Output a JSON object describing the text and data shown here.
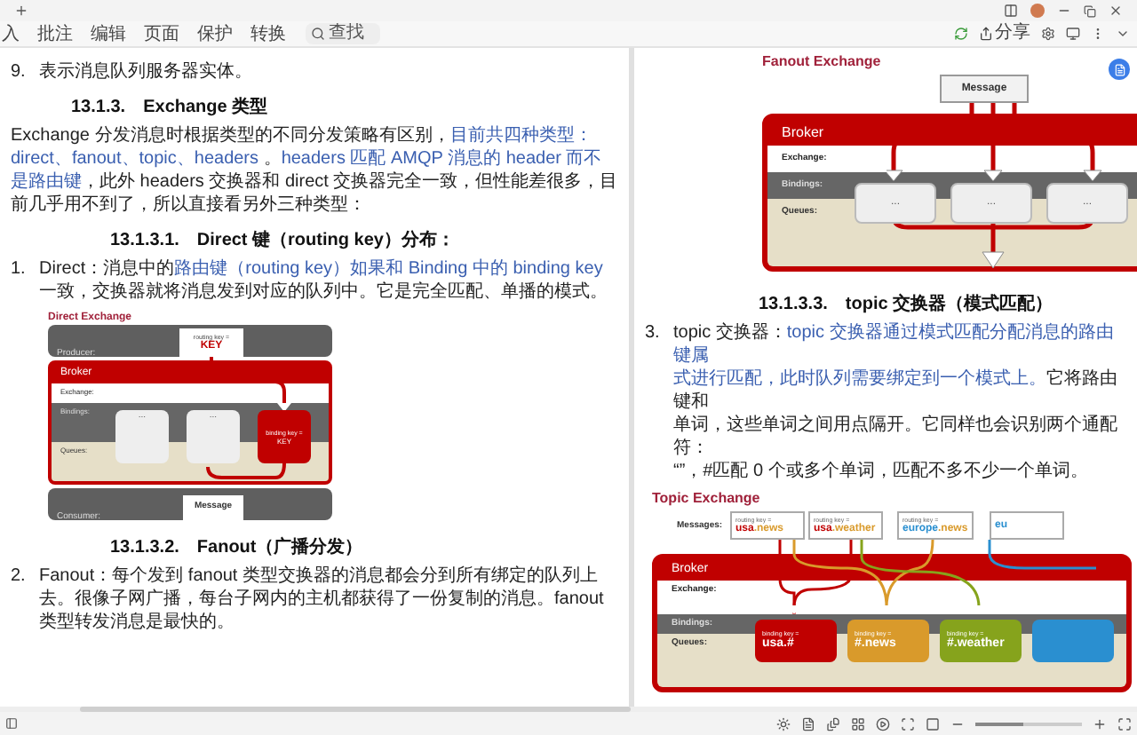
{
  "toolbar": {
    "tabs": [
      "入",
      "批注",
      "编辑",
      "页面",
      "保护",
      "转换"
    ],
    "search": {
      "placeholder": "查找"
    },
    "share_button": "分享"
  },
  "left_page": {
    "blocks": [
      {
        "kind": "list_item",
        "number": "9.",
        "segments": [
          {
            "text": "表示消息队列服务器实体。",
            "highlight": false
          }
        ]
      },
      {
        "kind": "heading",
        "number": "13.1.3.",
        "title": "Exchange 类型"
      },
      {
        "kind": "paragraph",
        "segments": [
          {
            "text": "Exchange 分发消息时根据类型的不同分发策略有区别，",
            "highlight": false
          },
          {
            "text": "目前共四种类型：direct、fanout、topic、headers",
            "highlight": true
          },
          {
            "text": " 。",
            "highlight": false
          },
          {
            "text": "headers 匹配 AMQP 消息的 header 而不是路由键",
            "highlight": true
          },
          {
            "text": "，此外 headers 交换器和 direct 交换器完全一致，但性能差很多，目前几乎用不到了，所以直接看另外三种类型：",
            "highlight": false
          }
        ]
      },
      {
        "kind": "subheading",
        "number": "13.1.3.1.",
        "title": "Direct 键（routing key）分布："
      },
      {
        "kind": "list_item",
        "number": "1.",
        "segments": [
          {
            "text": "Direct：消息中的",
            "highlight": false
          },
          {
            "text": "路由键（routing key）如果和 Binding 中的 binding key",
            "highlight": true
          },
          {
            "text": " 一致，交换器就将消息发到对应的队列中。它是完全匹配、单播的模式。",
            "highlight": false
          }
        ]
      },
      {
        "kind": "direct_diagram",
        "title": "Direct Exchange",
        "producer_label": "Producer:",
        "message": {
          "caption": "routing key =",
          "key": "KEY"
        },
        "broker_label": "Broker",
        "rows": [
          {
            "kind": "exchange",
            "label": "Exchange:"
          },
          {
            "kind": "bindings",
            "label": "Bindings:"
          },
          {
            "kind": "queues",
            "label": "Queues:"
          }
        ],
        "queues": [
          {
            "kind": "plain",
            "text": "..."
          },
          {
            "kind": "plain",
            "text": "..."
          },
          {
            "kind": "matched",
            "caption": "binding key =",
            "key": "KEY"
          }
        ],
        "consumer_label": "Consumer:",
        "consumer_message": "Message"
      },
      {
        "kind": "subheading",
        "number": "13.1.3.2.",
        "title": "Fanout（广播分发）"
      },
      {
        "kind": "list_item",
        "number": "2.",
        "segments": [
          {
            "text": "Fanout：每个发到 fanout 类型交换器的消息都会分到所有绑定的队列上去。很像子网广播，每台子网内的主机都获得了一份复制的消息。fanout 类型转发消息是最快的。",
            "highlight": false
          }
        ]
      }
    ]
  },
  "right_page": {
    "blocks": [
      {
        "kind": "fanout_diagram",
        "title": "Fanout Exchange",
        "message": "Message",
        "broker_label": "Broker",
        "rows": [
          {
            "kind": "exchange",
            "label": "Exchange:"
          },
          {
            "kind": "bindings",
            "label": "Bindings:"
          },
          {
            "kind": "queues",
            "label": "Queues:"
          }
        ],
        "queues": [
          "...",
          "...",
          "..."
        ]
      },
      {
        "kind": "subheading",
        "number": "13.1.3.3.",
        "title": "topic 交换器（模式匹配）"
      },
      {
        "kind": "list_item",
        "number": "3.",
        "lines": [
          [
            {
              "text": "topic 交换器：",
              "highlight": false
            },
            {
              "text": "topic 交换器通过模式匹配分配消息的路由键属",
              "highlight": true
            }
          ],
          [
            {
              "text": "式进行匹配，此时队列需要绑定到一个模式上。",
              "highlight": true
            },
            {
              "text": "它将路由键和",
              "highlight": false
            }
          ],
          [
            {
              "text": "单词，这些单词之间用点隔开。它同样也会识别两个通配符：",
              "highlight": false
            }
          ],
          [
            {
              "text": "“”，#匹配 0 个或多个单词，匹配不多不少一个单词。",
              "highlight": false
            }
          ]
        ]
      },
      {
        "kind": "topic_diagram",
        "title": "Topic Exchange",
        "messages_label": "Messages:",
        "broker_label": "Broker",
        "rows": [
          {
            "kind": "exchange",
            "label": "Exchange:"
          },
          {
            "kind": "bindings",
            "label": "Bindings:"
          },
          {
            "kind": "queues",
            "label": "Queues:"
          }
        ],
        "messages": [
          {
            "caption": "routing key =",
            "parts": [
              {
                "text": "usa",
                "color": "#c00000"
              },
              {
                "text": ".news",
                "color": "#d99a2b"
              }
            ]
          },
          {
            "caption": "routing key =",
            "parts": [
              {
                "text": "usa",
                "color": "#c00000"
              },
              {
                "text": ".weather",
                "color": "#d99a2b"
              }
            ]
          },
          {
            "caption": "routing key =",
            "parts": [
              {
                "text": "europe",
                "color": "#2a8fd0"
              },
              {
                "text": ".news",
                "color": "#d99a2b"
              }
            ]
          },
          {
            "parts": [
              {
                "text": "eu",
                "color": "#2a8fd0"
              }
            ]
          }
        ],
        "queues": [
          {
            "caption": "binding key =",
            "key": "usa.#",
            "color": "#c00000"
          },
          {
            "caption": "binding key =",
            "key": "#.news",
            "color": "#d99a2b"
          },
          {
            "caption": "binding key =",
            "key": "#.weather",
            "color": "#86a31c"
          },
          {
            "color": "#2a8fd0"
          }
        ]
      }
    ]
  },
  "status_bar": {
    "zoom_slider": {
      "level": 0.45
    }
  }
}
